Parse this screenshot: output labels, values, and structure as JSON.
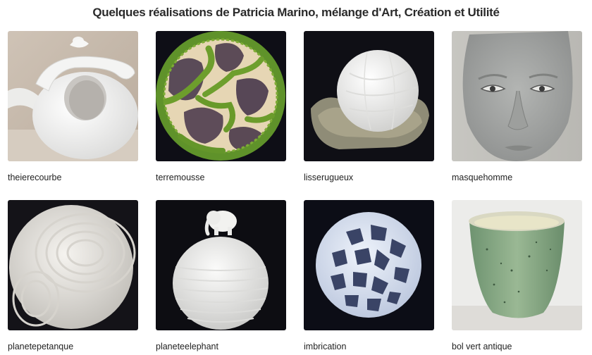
{
  "title": "Quelques réalisations de Patricia Marino, mélange d'Art, Création et Utilité",
  "gallery": {
    "items": [
      {
        "label": "theierecourbe"
      },
      {
        "label": "terremousse"
      },
      {
        "label": "lisserugueux"
      },
      {
        "label": "masquehomme"
      },
      {
        "label": "planetepetanque"
      },
      {
        "label": "planeteelephant"
      },
      {
        "label": "imbrication"
      },
      {
        "label": "bol vert antique"
      }
    ]
  },
  "colors": {
    "dark_bg": "#0c0c14",
    "white_ceramic": "#f1f1ef",
    "moss_green": "#6a9a2a",
    "stone_purple": "#5e4a5a",
    "grey_clay": "#a9aaa8",
    "bowl_green": "#8fb08a"
  }
}
